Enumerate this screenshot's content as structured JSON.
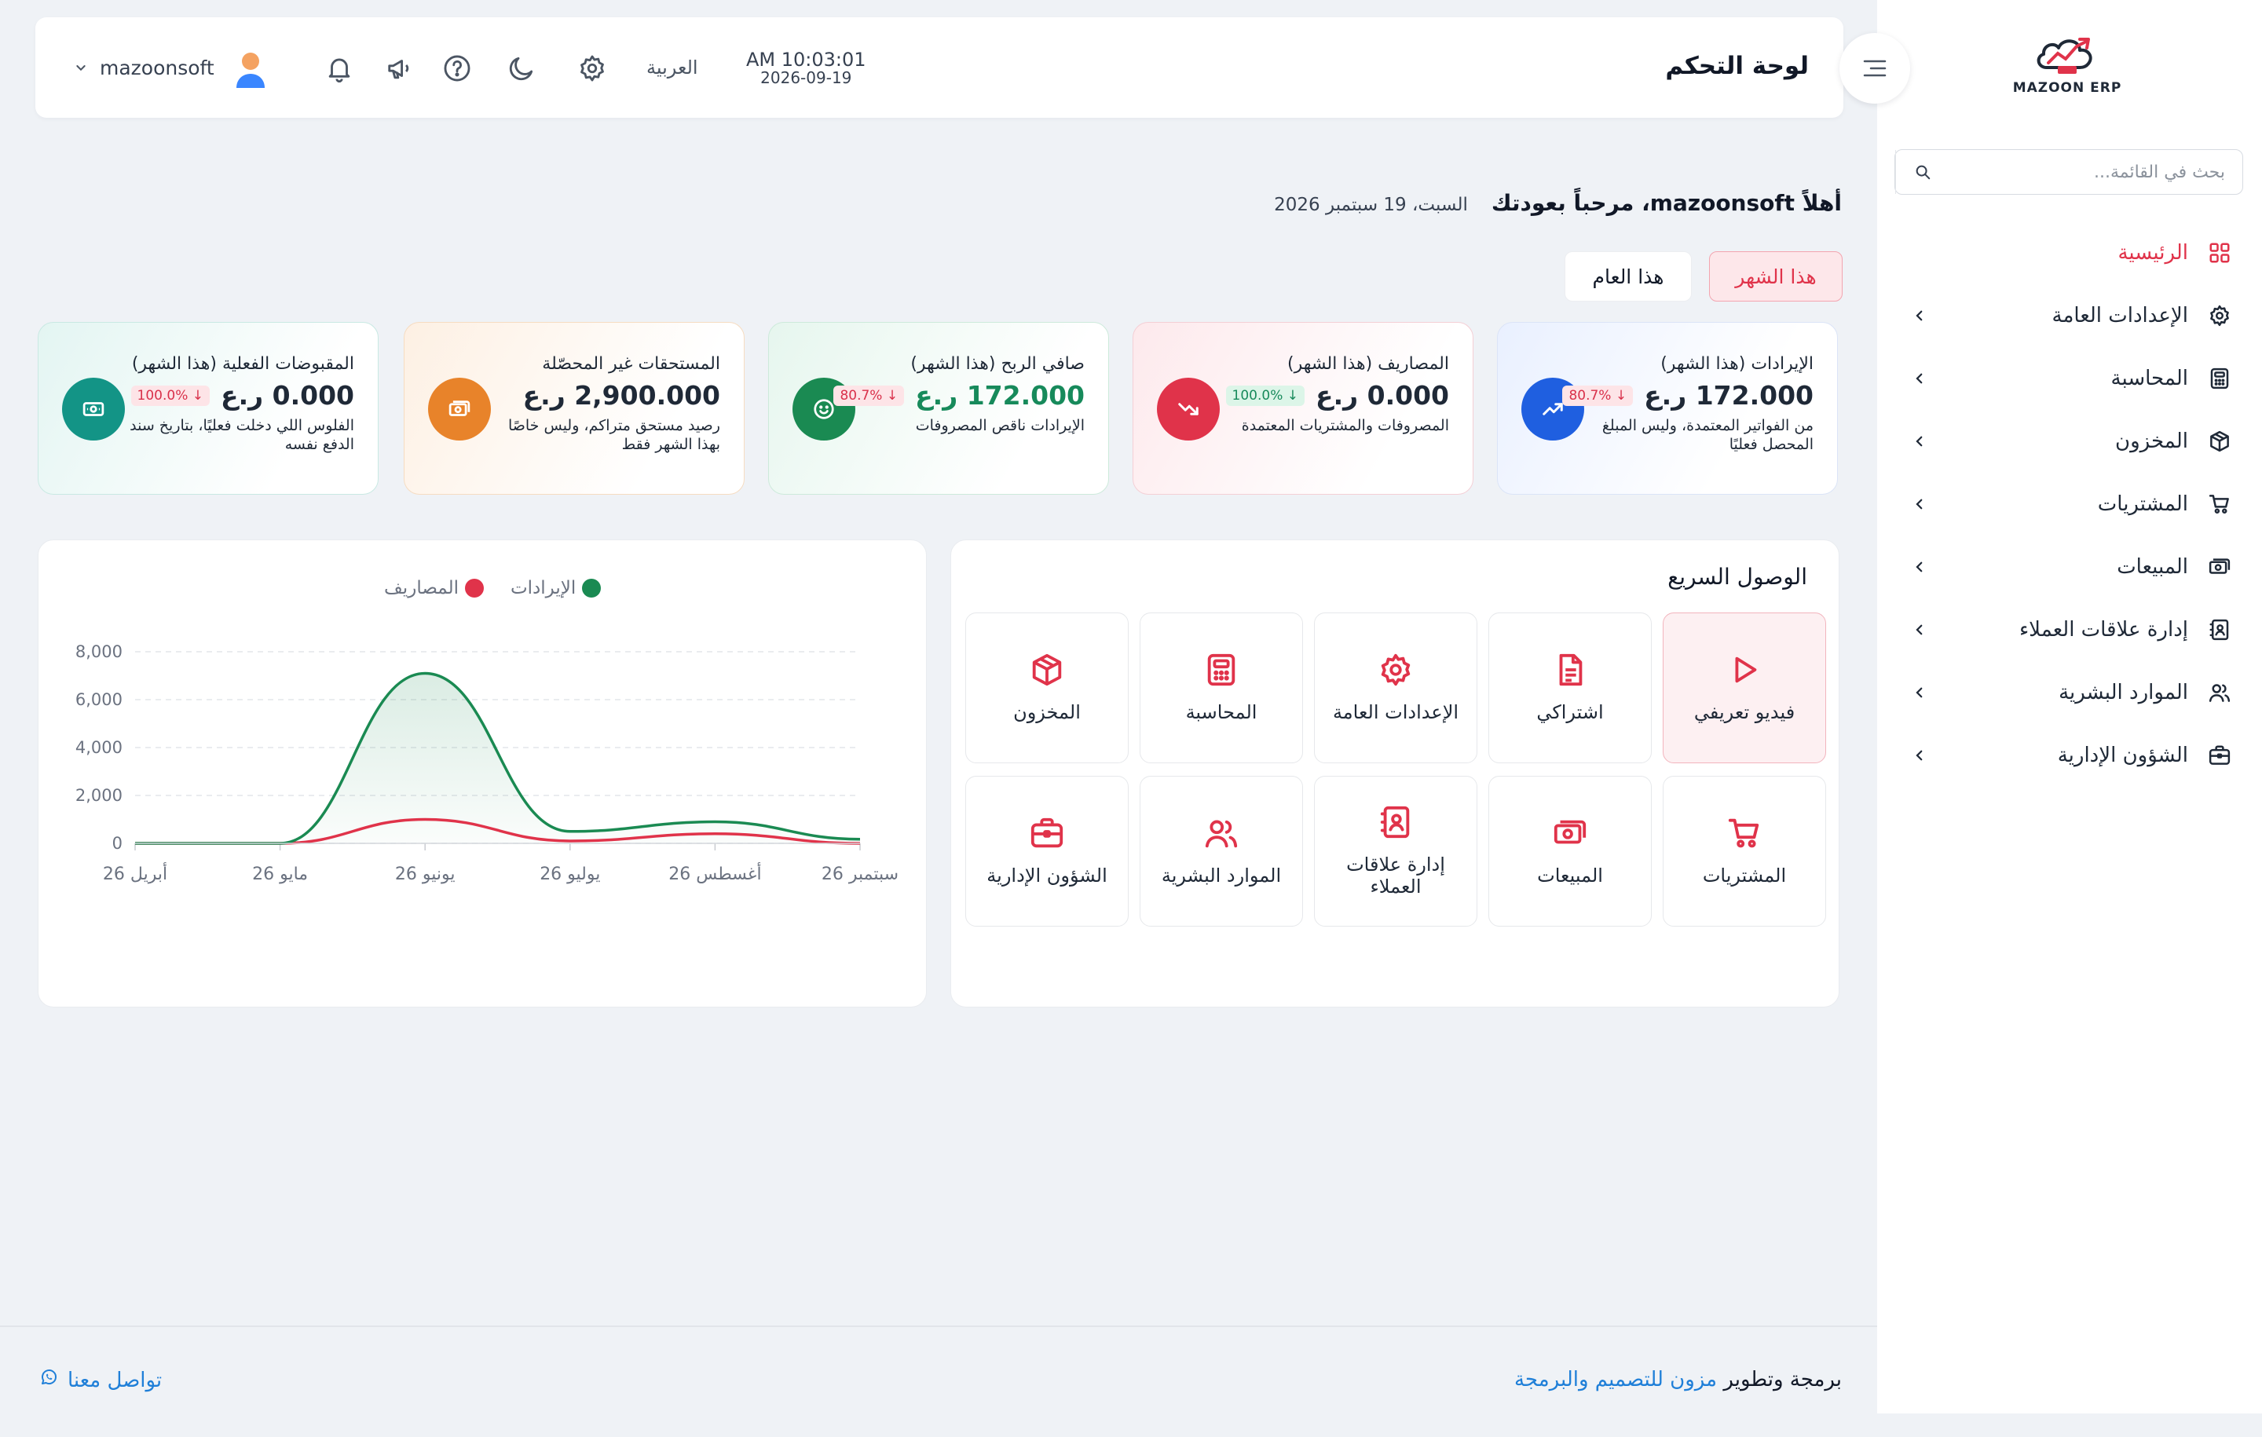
{
  "brand": {
    "name": "MAZOON ERP",
    "tag": "ERP"
  },
  "sidebar": {
    "search_placeholder": "بحث في القائمة...",
    "items": [
      {
        "label": "الرئيسية",
        "icon": "grid-icon",
        "active": true
      },
      {
        "label": "الإعدادات العامة",
        "icon": "gear-icon"
      },
      {
        "label": "المحاسبة",
        "icon": "calculator-icon"
      },
      {
        "label": "المخزون",
        "icon": "box-icon"
      },
      {
        "label": "المشتريات",
        "icon": "cart-icon"
      },
      {
        "label": "المبيعات",
        "icon": "cash-icon"
      },
      {
        "label": "إدارة علاقات العملاء",
        "icon": "contacts-icon"
      },
      {
        "label": "الموارد البشرية",
        "icon": "users-icon"
      },
      {
        "label": "الشؤون الإدارية",
        "icon": "briefcase-icon"
      }
    ]
  },
  "header": {
    "title": "لوحة التحكم",
    "time": "AM 10:03:01",
    "date": "2026-09-19",
    "language": "العربية",
    "username": "mazoonsoft"
  },
  "welcome": {
    "greeting": "أهلاً mazoonsoft، مرحباً بعودتك",
    "date": "السبت، 19 سبتمبر 2026"
  },
  "periods": {
    "month": "هذا الشهر",
    "year": "هذا العام"
  },
  "stats": [
    {
      "label": "الإيرادات (هذا الشهر)",
      "value": "172.000 ر.ع",
      "badge": "↓ 80.7%",
      "desc": "من الفواتير المعتمدة، وليس المبلغ المحصل فعليًا"
    },
    {
      "label": "المصاريف (هذا الشهر)",
      "value": "0.000 ر.ع",
      "badge": "↓ 100.0%",
      "desc": "المصروفات والمشتريات المعتمدة"
    },
    {
      "label": "صافي الربح (هذا الشهر)",
      "value": "172.000 ر.ع",
      "badge": "↓ 80.7%",
      "desc": "الإيرادات ناقص المصروفات"
    },
    {
      "label": "المستحقات غير المحصّلة",
      "value": "2,900.000 ر.ع",
      "desc": "رصيد مستحق متراكم، وليس خاصًا بهذا الشهر فقط"
    },
    {
      "label": "المقبوضات الفعلية (هذا الشهر)",
      "value": "0.000 ر.ع",
      "badge": "↓ 100.0%",
      "desc": "الفلوس اللي دخلت فعليًا، بتاريخ سند الدفع نفسه"
    }
  ],
  "quick_access": {
    "title": "الوصول السريع",
    "tiles": [
      {
        "label": "فيديو تعريفي",
        "icon": "play-icon"
      },
      {
        "label": "اشتراكي",
        "icon": "document-icon"
      },
      {
        "label": "الإعدادات العامة",
        "icon": "gear-icon"
      },
      {
        "label": "المحاسبة",
        "icon": "calculator-icon"
      },
      {
        "label": "المخزون",
        "icon": "box-icon"
      },
      {
        "label": "المشتريات",
        "icon": "cart-icon"
      },
      {
        "label": "المبيعات",
        "icon": "cash-icon"
      },
      {
        "label": "إدارة علاقات العملاء",
        "icon": "contacts-icon"
      },
      {
        "label": "الموارد البشرية",
        "icon": "users-icon"
      },
      {
        "label": "الشؤون الإدارية",
        "icon": "briefcase-icon"
      }
    ]
  },
  "chart_data": {
    "type": "line",
    "categories": [
      "أبريل 26",
      "مايو 26",
      "يونيو 26",
      "يوليو 26",
      "أغسطس 26",
      "سبتمبر 26"
    ],
    "ylim": [
      0,
      8000
    ],
    "yticks": [
      "0",
      "2,000",
      "4,000",
      "6,000",
      "8,000"
    ],
    "grid": true,
    "legend_position": "top",
    "series": [
      {
        "name": "الإيرادات",
        "color": "#1a8a52",
        "values": [
          0,
          0,
          7100,
          500,
          900,
          172
        ]
      },
      {
        "name": "المصاريف",
        "color": "#e0334a",
        "values": [
          0,
          0,
          1000,
          100,
          400,
          0
        ]
      }
    ]
  },
  "footer": {
    "prefix": "برمجة وتطوير",
    "company": "مزون للتصميم والبرمجة",
    "contact": "تواصل معنا"
  },
  "colors": {
    "accent": "#e0334a",
    "revenue_icon_bg": "#1f5fe0",
    "expenses_icon_bg": "#e0334a",
    "profit_icon_bg": "#1a8a52",
    "receivables_icon_bg": "#e8832a",
    "receipts_icon_bg": "#139486",
    "link": "#1f7fd8"
  }
}
